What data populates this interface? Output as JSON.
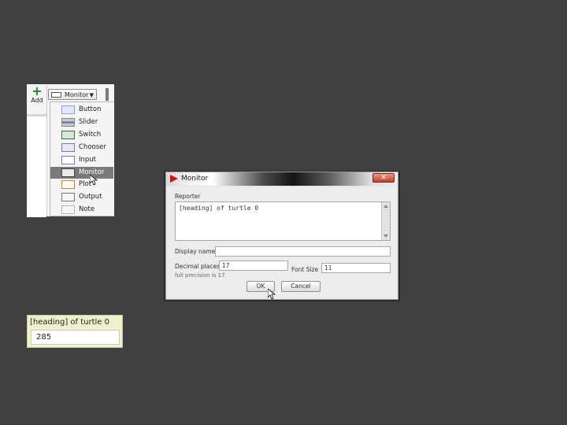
{
  "toolbar": {
    "add_label": "Add",
    "widget_type_selected": "Monitor"
  },
  "widget_menu": {
    "items": [
      {
        "label": "Button",
        "icon": "button-widget-icon",
        "selected": false
      },
      {
        "label": "Slider",
        "icon": "slider-widget-icon",
        "selected": false
      },
      {
        "label": "Switch",
        "icon": "switch-widget-icon",
        "selected": false
      },
      {
        "label": "Chooser",
        "icon": "chooser-widget-icon",
        "selected": false
      },
      {
        "label": "Input",
        "icon": "input-widget-icon",
        "selected": false
      },
      {
        "label": "Monitor",
        "icon": "monitor-widget-icon",
        "selected": true
      },
      {
        "label": "Plot",
        "icon": "plot-widget-icon",
        "selected": false
      },
      {
        "label": "Output",
        "icon": "output-widget-icon",
        "selected": false
      },
      {
        "label": "Note",
        "icon": "note-widget-icon",
        "selected": false
      }
    ]
  },
  "dialog": {
    "title": "Monitor",
    "close_glyph": "✕",
    "reporter_label": "Reporter",
    "reporter_value": "[heading] of turtle 0",
    "display_name_label": "Display name",
    "display_name_value": "",
    "decimal_places_label": "Decimal places",
    "decimal_places_value": "17",
    "precision_hint": "full precision is 17",
    "font_size_label": "Font Size",
    "font_size_value": "11",
    "ok_label": "OK",
    "cancel_label": "Cancel"
  },
  "monitor_widget": {
    "label": "[heading] of turtle 0",
    "value": "285"
  },
  "colors": {
    "background": "#404040",
    "add_plus": "#1f8a1f",
    "menu_selected": "#7a7a7a",
    "monitor_widget_bg": "#f0f0cc",
    "close_button": "#c5402a",
    "app_icon": "#c01818"
  }
}
